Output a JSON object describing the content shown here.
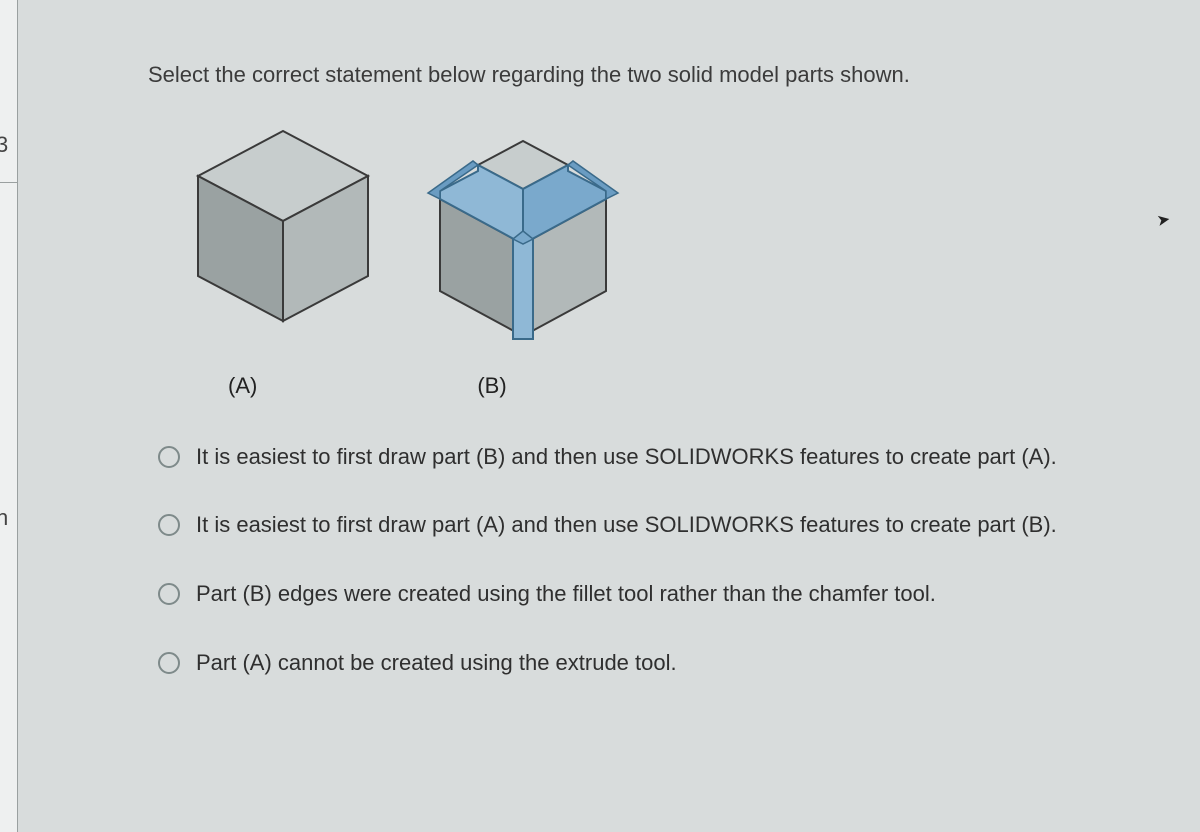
{
  "sidebar": {
    "digit": "3",
    "letter": "n"
  },
  "question": {
    "prompt": "Select the correct statement below regarding the two solid model parts shown.",
    "labelA": "(A)",
    "labelB": "(B)",
    "options": [
      "It is easiest to first draw part (B) and then use SOLIDWORKS features to create part (A).",
      "It is easiest to first draw part (A) and then use SOLIDWORKS features to create part (B).",
      "Part (B) edges were created using the fillet tool rather than the chamfer tool.",
      "Part (A) cannot be created using the extrude tool."
    ]
  }
}
